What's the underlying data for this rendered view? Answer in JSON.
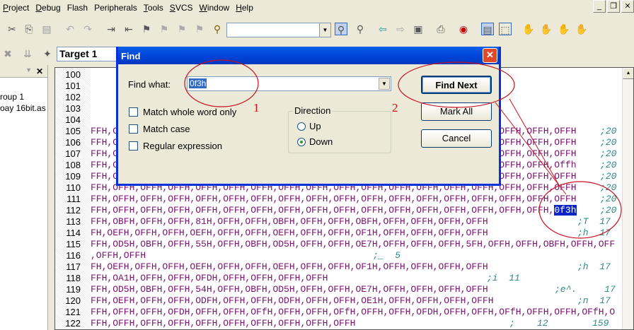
{
  "menu": [
    "Project",
    "Debug",
    "Flash",
    "Peripherals",
    "Tools",
    "SVCS",
    "Window",
    "Help"
  ],
  "menu_underline": [
    "P",
    "D",
    "a",
    "r",
    "T",
    "S",
    "W",
    "H"
  ],
  "toolbar": {
    "search_combo_value": "",
    "target": "Target 1"
  },
  "project_panel": {
    "items": [
      "roup 1",
      "oay 16bit.as"
    ]
  },
  "editor": {
    "lines": [
      {
        "n": "100",
        "code": "",
        "cmt": ""
      },
      {
        "n": "101",
        "code": "",
        "cmt": ""
      },
      {
        "n": "102",
        "code": "",
        "cmt": ""
      },
      {
        "n": "103",
        "code": "",
        "cmt": ""
      },
      {
        "n": "104",
        "code": "",
        "cmt": ""
      },
      {
        "n": "105",
        "code": "FFH,OFFH,OFFH,OFFH,OFFH,OFFH,OFFH,OFFH,OFFH,OFFH,OFFH,OFFH,OFFH,OFFH,OFFH,OFFH,OFFH,OFFH",
        "cmt": ";20"
      },
      {
        "n": "106",
        "code": "FFH,OFFH,OFFH,OFFH,OFFH,OFFH,OFFH,OFFH,OFFH,OFFH,OFFH,OFFH,OFFH,OFFH,OFFH,OFFH,OFFH,OFFH",
        "cmt": ";20"
      },
      {
        "n": "107",
        "code": "FFH,OFFH,OFFH,OFFH,OFFH,OFFH,OFFH,OFFH,OFFH,OFFH,OFFH,OFFH,OFFH,OFFH,OFFH,OFFH,OFFH,OFFH",
        "cmt": ";20"
      },
      {
        "n": "108",
        "code": "FFH,OFFH,OFFH,OFFH,OFFH,OFFH,OFFH,OFFH,OFFH,OFFH,OFFH,OFFH,OFFH,OFFH,OFFH,OFFH,OFFH,Offh",
        "cmt": ";20"
      },
      {
        "n": "109",
        "code": "FFH,OFFH,OFFH,OFFH,OFFH,OFFH,OFFH,OFFH,OFFH,OFFH,OFFH,OFFH,OFFH,OFFH,OFFH,OFFH,OFFH,OFFH",
        "cmt": ";20"
      },
      {
        "n": "110",
        "code": "FFH,OFFH,OFFH,OFFH,OFFH,OFFH,OFFH,OFFH,OFFH,OFFH,OFFH,OFFH,OFFH,OFFH,OFFH,OFFH,OFFH,OFFH",
        "cmt": ";20"
      },
      {
        "n": "111",
        "code": "FFH,OFFH,OFFH,OFFH,OFFH,OFFH,OFFH,OFFH,OFFH,OFFH,OFFH,OFFH,OFFH,OFFH,OFFH,OFFH,OFFH,OFFH",
        "cmt": ";20"
      },
      {
        "n": "112",
        "code": "FFH,OFFH,OFFH,OFFH,OFFH,OFFH,OFFH,OFFH,OFFH,OFFH,OFFH,OFFH,OFFH,OFFH,OFFH,OFFH,OFFH,",
        "hl": "0f3h",
        "cmt": ";20"
      },
      {
        "n": "113",
        "code": "FFH,OBFH,OFFH,OFFH,81H,OFFH,OFFH,OBFH,OFFH,OFFH,OBFH,OFFH,OFFH,OFFH,OFFH",
        "cmt": ";T  17"
      },
      {
        "n": "114",
        "code": "FH,OEFH,OFFH,OFFH,OEFH,OFFH,OFFH,OEFH,OFFH,OFFH,OF1H,OFFH,OFFH,OFFH,OFFH",
        "cmt": ";h  17"
      },
      {
        "n": "115",
        "code": "FFH,OD5H,OBFH,OFFH,55H,OFFH,OBFH,OD5H,OFFH,OFFH,OE7H,OFFH,OFFH,OFFH,5FH,OFFH,OFFH,OBFH,OFFH,OFF",
        "cmt": ""
      },
      {
        "n": "116",
        "code": ",OFFH,OFFH",
        "cmt": ";_  5"
      },
      {
        "n": "117",
        "code": "FH,OEFH,OFFH,OFFH,OEFH,OFFH,OFFH,OEFH,OFFH,OFFH,OF1H,OFFH,OFFH,OFFH,OFFH",
        "cmt": ";h  17"
      },
      {
        "n": "118",
        "code": "FFH,OA1H,OFFH,OFFH,OFDH,OFFH,OFFH,OFFH,OFFH",
        "cmt": ";i  11"
      },
      {
        "n": "119",
        "code": "FFH,OD5H,OBFH,OFFH,54H,OFFH,OBFH,OD5H,OFFH,OFFH,OE7H,OFFH,OFFH,OFFH,OFFH",
        "cmt": ";e^.     17"
      },
      {
        "n": "120",
        "code": "FFH,OEFH,OFFH,OFFH,ODFH,OFFH,OFFH,ODFH,OFFH,OFFH,OE1H,OFFH,OFFH,OFFH,OFFH",
        "cmt": ";n  17"
      },
      {
        "n": "121",
        "code": "FFH,OFFH,OFFH,OFDH,OFFH,OFFH,OFfH,OFFH,OFFH,OFfH,OFFH,OFFH,OFDH,OFFH,OFFH,OFfH,OFFH,OFFH,OFfH,O",
        "cmt": ""
      },
      {
        "n": "122",
        "code": "FFH,OFFH,OFFH,OFFH,OFFH,OFFH,OFFH,OFFH,OFFH,OFFH",
        "cmt": ";    12        159"
      }
    ]
  },
  "find_dialog": {
    "title": "Find",
    "find_what_label": "Find what:",
    "find_what_value": "0f3h",
    "match_whole_word": "Match whole word only",
    "match_case": "Match case",
    "regex": "Regular expression",
    "direction_label": "Direction",
    "up": "Up",
    "down": "Down",
    "direction_selected": "Down",
    "find_next": "Find Next",
    "mark_all": "Mark All",
    "cancel": "Cancel"
  },
  "annotations": {
    "label1": "1",
    "label2": "2",
    "color": "#d01010"
  }
}
